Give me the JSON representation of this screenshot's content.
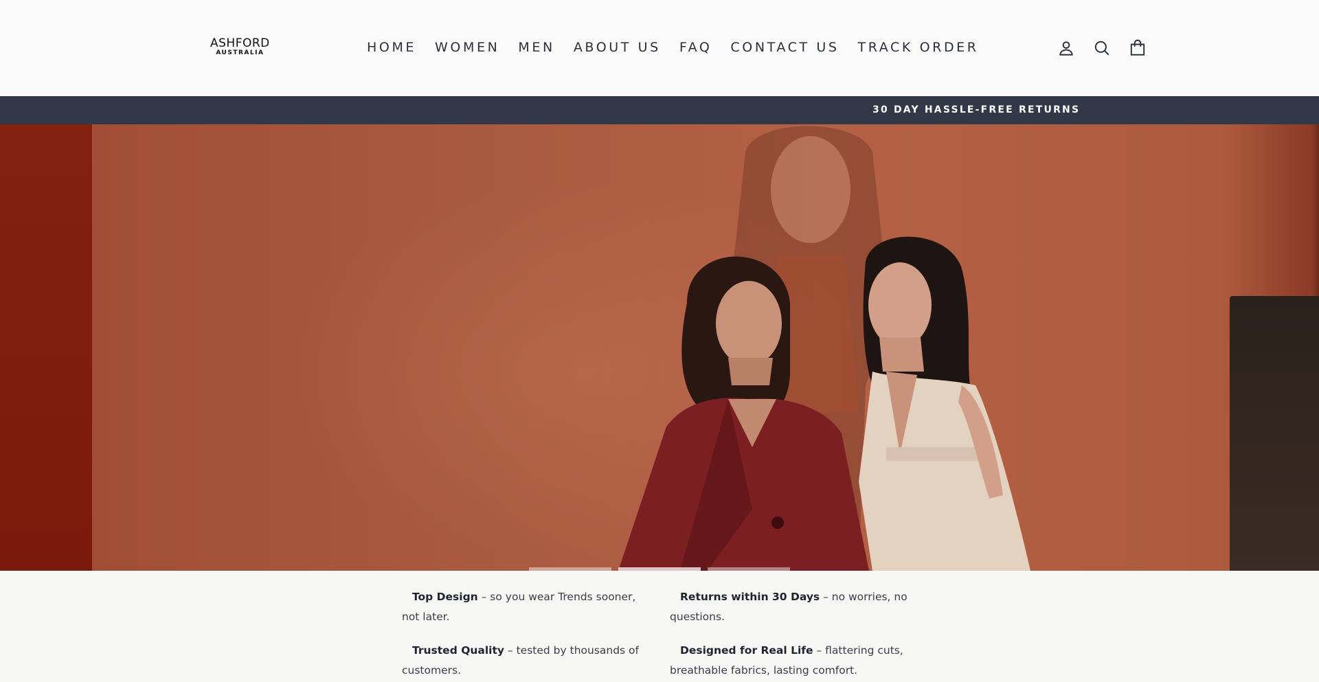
{
  "brand": {
    "name": "ASHFORD",
    "subtitle": "AUSTRALIA"
  },
  "nav": {
    "items": [
      {
        "label": "HOME"
      },
      {
        "label": "WOMEN"
      },
      {
        "label": "MEN"
      },
      {
        "label": "ABOUT US"
      },
      {
        "label": "FAQ"
      },
      {
        "label": "CONTACT US"
      },
      {
        "label": "TRACK ORDER"
      }
    ]
  },
  "header_icons": [
    "account-icon",
    "search-icon",
    "cart-icon"
  ],
  "announcement": {
    "text": "30 DAY HASSLE-FREE RETURNS"
  },
  "hero": {
    "slides_count": 3,
    "active_slide": 2
  },
  "features": [
    {
      "title": "Top Design",
      "text": " – so you wear Trends sooner, not later."
    },
    {
      "title": "Returns within 30 Days",
      "text": " – no worries, no questions."
    },
    {
      "title": "Trusted Quality",
      "text": " – tested by thousands of customers."
    },
    {
      "title": "Designed for Real Life",
      "text": " – flattering cuts, breathable fabrics, lasting comfort."
    }
  ],
  "colors": {
    "announcement_bg": "#323847",
    "hero_bg": "#a85a40",
    "text": "#2b2f3a"
  }
}
